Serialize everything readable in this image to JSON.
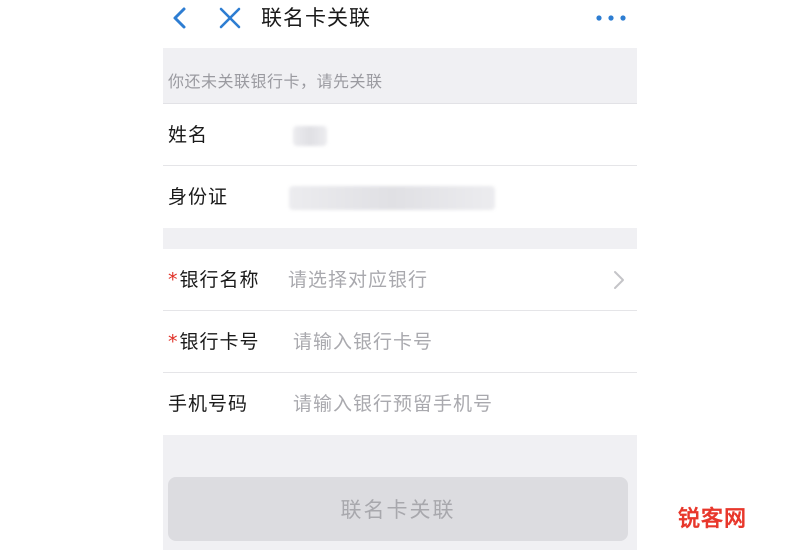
{
  "nav": {
    "title": "联名卡关联",
    "back_icon": "chevron-left-icon",
    "close_icon": "close-icon",
    "more_icon": "more-icon"
  },
  "notice": {
    "text": "你还未关联银行卡，请先关联"
  },
  "identity": {
    "name_label": "姓名",
    "id_label": "身份证"
  },
  "bank_form": {
    "required_mark": "*",
    "bank_name_label": "银行名称",
    "bank_name_placeholder": "请选择对应银行",
    "card_number_label": "银行卡号",
    "card_number_placeholder": "请输入银行卡号",
    "phone_label": "手机号码",
    "phone_placeholder": "请输入银行预留手机号"
  },
  "submit": {
    "label": "联名卡关联"
  },
  "watermark": {
    "text": "锐客网"
  },
  "colors": {
    "accent": "#2d7dd2",
    "required": "#e02e24",
    "background": "#f0f0f3",
    "disabled_button": "#dcdce0"
  }
}
